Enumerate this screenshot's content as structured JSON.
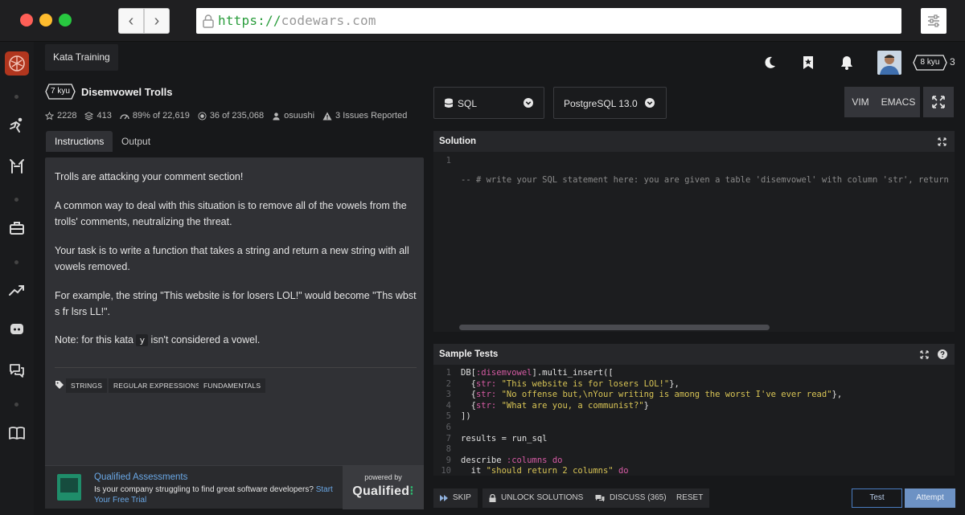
{
  "browser": {
    "url_scheme": "https://",
    "url_host": "codewars.com"
  },
  "topbar": {
    "section_tab": "Kata Training",
    "rank": "8 kyu",
    "honor": "3"
  },
  "kata": {
    "rank": "7 kyu",
    "title": "Disemvowel Trolls",
    "stats": {
      "stars": "2228",
      "collections": "413",
      "satisfaction": "89%",
      "satisfaction_of": "of 22,619",
      "completed": "36",
      "completed_of": "of 235,068",
      "author": "osuushi",
      "issues": "3 Issues Reported"
    }
  },
  "tabs": {
    "instructions": "Instructions",
    "output": "Output"
  },
  "instructions": {
    "p1": "Trolls are attacking your comment section!",
    "p2": "A common way to deal with this situation is to remove all of the vowels from the trolls' comments, neutralizing the threat.",
    "p3": "Your task is to write a function that takes a string and return a new string with all vowels removed.",
    "p4": "For example, the string \"This website is for losers LOL!\" would become \"Ths wbst s fr lsrs LL!\".",
    "p5_before": "Note: for this kata ",
    "p5_code": "y",
    "p5_after": " isn't considered a vowel."
  },
  "tags": [
    "Strings",
    "Regular Expressions",
    "Fundamentals"
  ],
  "promo": {
    "title": "Qualified Assessments",
    "text": "Is your company struggling to find great software developers?",
    "link": "Start Your Free Trial",
    "powered_by": "powered by",
    "brand": "Qualified"
  },
  "editor": {
    "language": "SQL",
    "version": "PostgreSQL 13.0",
    "vim": "VIM",
    "emacs": "EMACS",
    "solution_title": "Solution",
    "solution_line": "-- # write your SQL statement here: you are given a table 'disemvowel' with column 'str', return a tab",
    "tests_title": "Sample Tests",
    "line_numbers": [
      "1",
      "2",
      "3",
      "4",
      "5",
      "6",
      "7",
      "8",
      "9",
      "10"
    ]
  },
  "actions": {
    "skip": "Skip",
    "unlock": "Unlock Solutions",
    "discuss": "Discuss (365)",
    "reset": "Reset",
    "test": "Test",
    "attempt": "Attempt"
  },
  "colors": {
    "codewars_red": "#b1361e",
    "link_blue": "#6aa8e6",
    "attempt_blue": "#6d92c4",
    "string_yellow": "#d8c455",
    "symbol_pink": "#d65ba4"
  }
}
